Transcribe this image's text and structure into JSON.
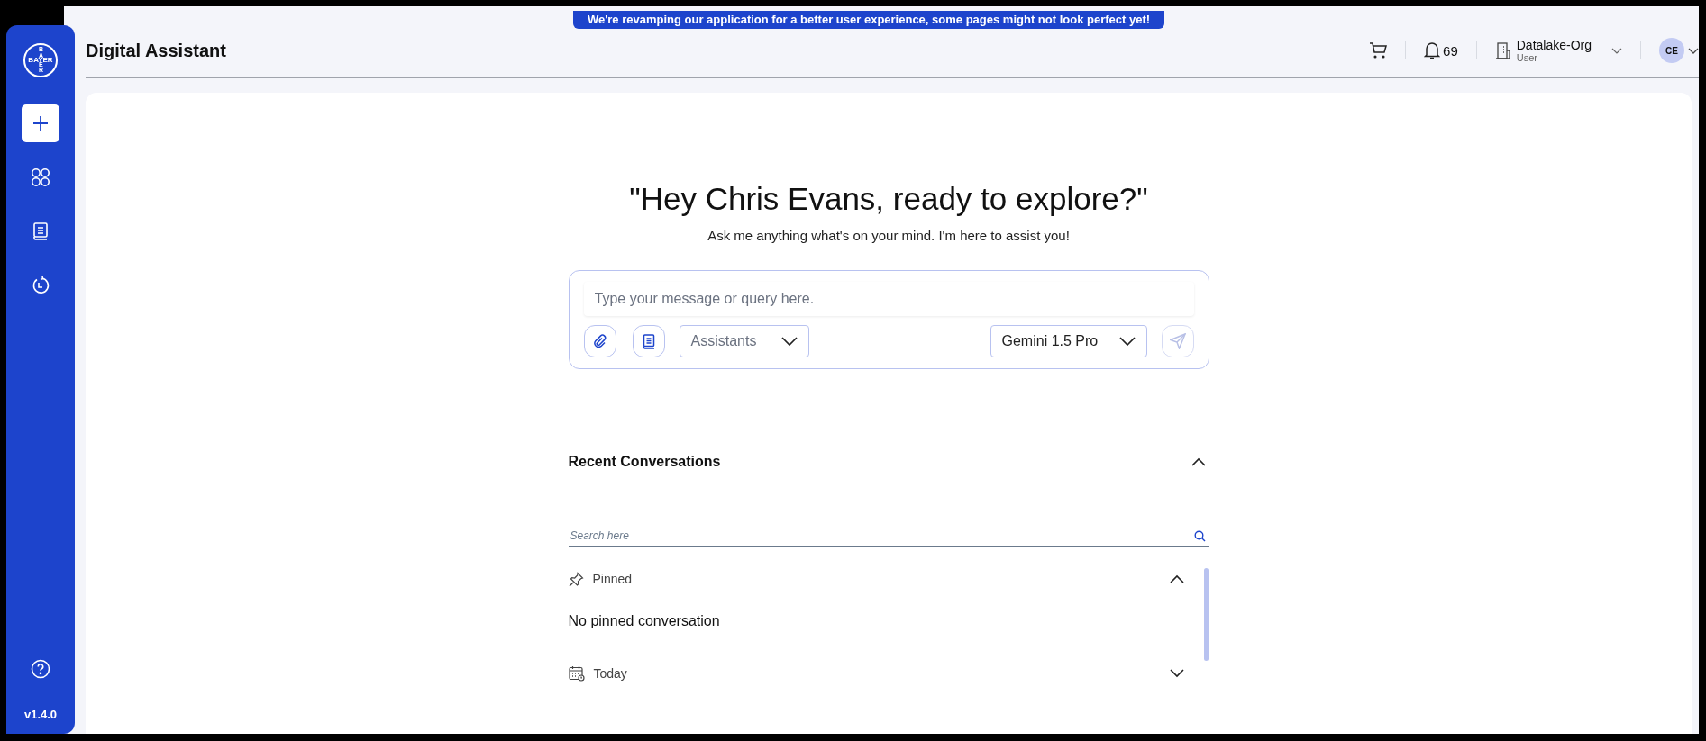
{
  "banner": {
    "text": "We're revamping our application for a better user experience, some pages might not look perfect yet!"
  },
  "sidebar": {
    "logo": {
      "horizontal": "BAYER",
      "vertical_top": "BA",
      "vertical_bottom": "ER"
    },
    "items": [
      {
        "kind": "new",
        "selected": true
      },
      {
        "kind": "apps",
        "selected": false
      },
      {
        "kind": "library",
        "selected": false
      },
      {
        "kind": "history",
        "selected": false
      }
    ],
    "version": "v1.4.0"
  },
  "header": {
    "title": "Digital Assistant",
    "notifications": {
      "count": "69"
    },
    "org": {
      "name": "Datalake-Org",
      "role": "User"
    },
    "avatar": {
      "initials": "CE"
    }
  },
  "greeting": {
    "title": "\"Hey Chris Evans, ready to explore?\"",
    "subtitle": "Ask me anything what's on your mind. I'm here to assist you!"
  },
  "composer": {
    "placeholder": "Type your message or query here.",
    "assistants": {
      "placeholder": "Assistants"
    },
    "model": {
      "value": "Gemini 1.5 Pro"
    },
    "send": {
      "disabled": true
    }
  },
  "recent": {
    "title": "Recent Conversations",
    "expanded": true,
    "search": {
      "placeholder": "Search here"
    },
    "groups": [
      {
        "kind": "pinned",
        "label": "Pinned",
        "expanded": true,
        "empty_text": "No pinned conversation"
      },
      {
        "kind": "today",
        "label": "Today",
        "expanded": false
      }
    ]
  }
}
